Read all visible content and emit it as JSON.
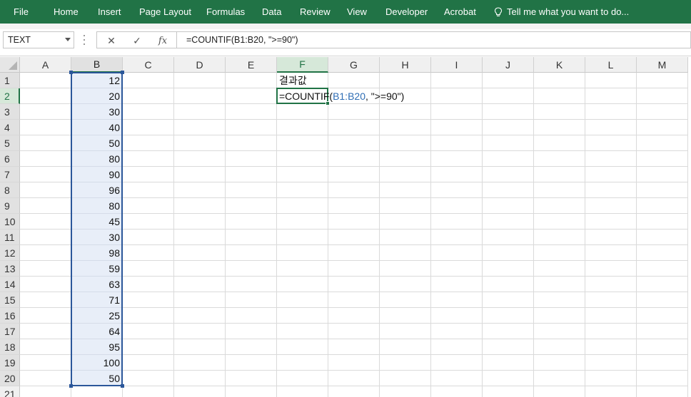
{
  "ribbon": {
    "tabs": [
      "File",
      "Home",
      "Insert",
      "Page Layout",
      "Formulas",
      "Data",
      "Review",
      "View",
      "Developer",
      "Acrobat"
    ],
    "tell_me": "Tell me what you want to do..."
  },
  "formula_bar": {
    "name_box": "TEXT",
    "cancel_symbol": "✕",
    "enter_symbol": "✓",
    "fx_label": "fx",
    "formula": "=COUNTIF(B1:B20, \">=90\")"
  },
  "sheet": {
    "columns": [
      "A",
      "B",
      "C",
      "D",
      "E",
      "F",
      "G",
      "H",
      "I",
      "J",
      "K",
      "L",
      "M"
    ],
    "rows": [
      "1",
      "2",
      "3",
      "4",
      "5",
      "6",
      "7",
      "8",
      "9",
      "10",
      "11",
      "12",
      "13",
      "14",
      "15",
      "16",
      "17",
      "18",
      "19",
      "20",
      "21"
    ],
    "column_b_values": [
      "12",
      "20",
      "30",
      "40",
      "50",
      "80",
      "90",
      "96",
      "80",
      "45",
      "30",
      "98",
      "59",
      "63",
      "71",
      "25",
      "64",
      "95",
      "100",
      "50"
    ],
    "f1_label": "결과값",
    "f2_editing": {
      "prefix": "=COUNTIF(",
      "ref": "B1:B20",
      "suffix": ", \">=90\")"
    }
  },
  "colors": {
    "ribbon": "#217346",
    "range_border": "#2b579a",
    "range_fill": "#e8eef8",
    "ref_text": "#2f6eb5"
  }
}
